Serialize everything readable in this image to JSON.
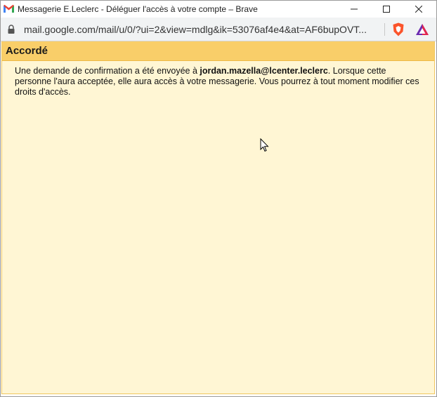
{
  "window": {
    "title": "Messagerie E.Leclerc - Déléguer l'accès à votre compte – Brave",
    "app_icon": "gmail-icon",
    "controls": {
      "minimize": "minimize-icon",
      "maximize": "maximize-icon",
      "close": "close-icon"
    }
  },
  "addressbar": {
    "url": "mail.google.com/mail/u/0/?ui=2&view=mdlg&ik=53076af4e4&at=AF6bupOVT...",
    "icons": [
      "lock-icon",
      "brave-shield-icon",
      "brave-rewards-icon"
    ]
  },
  "banner": {
    "title": "Accordé"
  },
  "message": {
    "before": "Une demande de confirmation a été envoyée à ",
    "email": "jordan.mazella@lcenter.leclerc",
    "after": ". Lorsque cette personne l'aura acceptée, elle aura accès à votre messagerie. Vous pourrez à tout moment modifier ces droits d'accès."
  },
  "colors": {
    "banner": "#f9ce69",
    "content_bg": "#fff6d4",
    "border": "#f0c75e"
  }
}
